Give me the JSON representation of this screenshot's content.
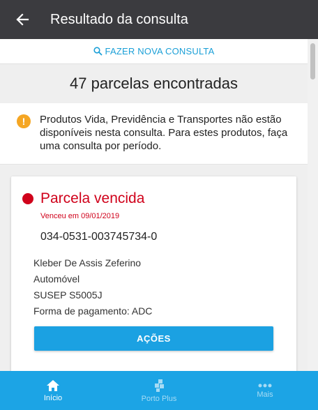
{
  "header": {
    "title": "Resultado da consulta",
    "back_icon": "arrow-left-icon"
  },
  "new_search": {
    "label": "FAZER NOVA CONSULTA",
    "icon": "search-icon"
  },
  "results": {
    "count_text": "47 parcelas encontradas"
  },
  "notice": {
    "icon": "warning-icon",
    "text": "Produtos Vida, Previdência e Transportes não estão disponíveis nesta consulta. Para estes produtos, faça uma consulta por período."
  },
  "card": {
    "status": "Parcela vencida",
    "due_date": "Venceu em 09/01/2019",
    "policy_number": "034-0531-003745734-0",
    "holder": "Kleber De Assis Zeferino",
    "product": "Automóvel",
    "susep": "SUSEP S5005J",
    "payment": "Forma de pagamento: ADC",
    "actions_label": "AÇÕES"
  },
  "bottom_nav": {
    "items": [
      {
        "label": "Início",
        "icon": "home-icon",
        "active": true
      },
      {
        "label": "Porto Plus",
        "icon": "porto-plus-icon",
        "active": false
      },
      {
        "label": "Mais",
        "icon": "more-icon",
        "active": false
      }
    ]
  },
  "colors": {
    "appbar": "#3b3b3f",
    "accent": "#1ca4e5",
    "overdue": "#d0021b",
    "warning": "#f5a623"
  }
}
